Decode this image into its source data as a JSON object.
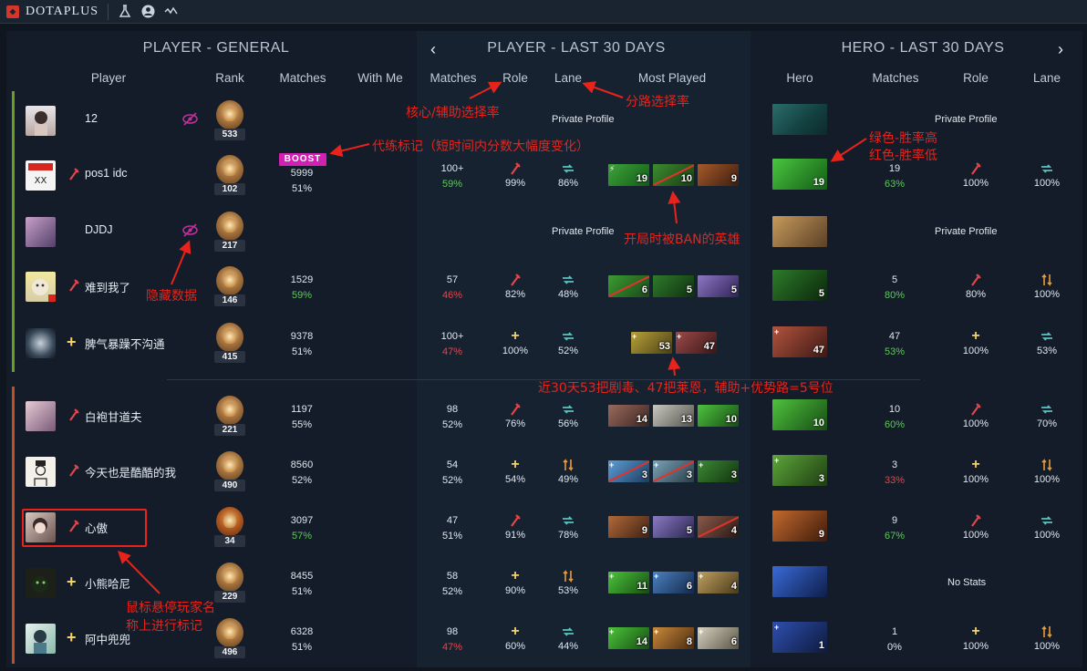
{
  "app": {
    "brand": "DOTAPLUS"
  },
  "sections": {
    "general": "PLAYER - GENERAL",
    "last30": "PLAYER - LAST 30 DAYS",
    "hero": "HERO - LAST 30 DAYS"
  },
  "headers": {
    "player": "Player",
    "rank": "Rank",
    "matches": "Matches",
    "with_me": "With Me",
    "matches2": "Matches",
    "role": "Role",
    "lane": "Lane",
    "most_played": "Most Played",
    "hero": "Hero",
    "hero_matches": "Matches",
    "hero_role": "Role",
    "hero_lane": "Lane"
  },
  "boost_label": "BOOST",
  "rows": [
    {
      "name": "12",
      "rank": "533",
      "private": "Private Profile",
      "hero_private": "Private Profile"
    },
    {
      "name": "pos1 idc",
      "rank": "102",
      "matches": "5999",
      "winrate": "51%",
      "m30": "100+",
      "m30_wr": "59%",
      "role_pct": "99%",
      "lane_pct": "86%",
      "mp": [
        "19",
        "10",
        "9"
      ],
      "hero_n": "19",
      "h_matches": "19",
      "h_wr": "63%",
      "h_role": "100%",
      "h_lane": "100%"
    },
    {
      "name": "DJDJ",
      "rank": "217",
      "private": "Private Profile",
      "hero_private": "Private Profile"
    },
    {
      "name": "难到我了",
      "rank": "146",
      "matches": "1529",
      "winrate": "59%",
      "m30": "57",
      "m30_wr": "46%",
      "role_pct": "82%",
      "lane_pct": "48%",
      "mp": [
        "6",
        "5",
        "5"
      ],
      "hero_n": "5",
      "h_matches": "5",
      "h_wr": "80%",
      "h_role": "80%",
      "h_lane": "100%"
    },
    {
      "name": "脾气暴躁不沟通",
      "rank": "415",
      "matches": "9378",
      "winrate": "51%",
      "m30": "100+",
      "m30_wr": "47%",
      "role_pct": "100%",
      "lane_pct": "52%",
      "mp": [
        "53",
        "47"
      ],
      "hero_n": "47",
      "h_matches": "47",
      "h_wr": "53%",
      "h_role": "100%",
      "h_lane": "53%"
    },
    {
      "name": "白袍甘道夫",
      "rank": "221",
      "matches": "1197",
      "winrate": "55%",
      "m30": "98",
      "m30_wr": "52%",
      "role_pct": "76%",
      "lane_pct": "56%",
      "mp": [
        "14",
        "13",
        "10"
      ],
      "hero_n": "10",
      "h_matches": "10",
      "h_wr": "60%",
      "h_role": "100%",
      "h_lane": "70%"
    },
    {
      "name": "今天也是酷酷的我",
      "rank": "490",
      "matches": "8560",
      "winrate": "52%",
      "m30": "54",
      "m30_wr": "52%",
      "role_pct": "54%",
      "lane_pct": "49%",
      "mp": [
        "3",
        "3",
        "3"
      ],
      "hero_n": "3",
      "h_matches": "3",
      "h_wr": "33%",
      "h_role": "100%",
      "h_lane": "100%"
    },
    {
      "name": "心傲",
      "rank": "34",
      "matches": "3097",
      "winrate": "57%",
      "m30": "47",
      "m30_wr": "51%",
      "role_pct": "91%",
      "lane_pct": "78%",
      "mp": [
        "9",
        "5",
        "4"
      ],
      "hero_n": "9",
      "h_matches": "9",
      "h_wr": "67%",
      "h_role": "100%",
      "h_lane": "100%"
    },
    {
      "name": "小熊哈尼",
      "rank": "229",
      "matches": "8455",
      "winrate": "51%",
      "m30": "58",
      "m30_wr": "52%",
      "role_pct": "90%",
      "lane_pct": "53%",
      "mp": [
        "11",
        "6",
        "4"
      ],
      "hero_no_stats": "No Stats"
    },
    {
      "name": "阿中兜兜",
      "rank": "496",
      "matches": "6328",
      "winrate": "51%",
      "m30": "98",
      "m30_wr": "47%",
      "role_pct": "60%",
      "lane_pct": "44%",
      "mp": [
        "14",
        "8",
        "6"
      ],
      "hero_n": "1",
      "h_matches": "1",
      "h_wr": "0%",
      "h_role": "100%",
      "h_lane": "100%"
    }
  ],
  "annotations": {
    "role_rate": "核心/辅助选择率",
    "lane_rate": "分路选择率",
    "boost_mark": "代练标记（短时间内分数大幅度变化）",
    "win_color_1": "绿色-胜率高",
    "win_color_2": "红色-胜率低",
    "banned": "开局时被BAN的英雄",
    "hidden": "隐藏数据",
    "summary": "近30天53把剧毒、47把莱恩，辅助+优势路=5号位",
    "hover_1": "鼠标悬停玩家名",
    "hover_2": "称上进行标记"
  },
  "colors": {
    "accent_red": "#e8231b",
    "win_green": "#5ec95a",
    "win_red": "#e0474c",
    "boost": "#d21fb4"
  }
}
